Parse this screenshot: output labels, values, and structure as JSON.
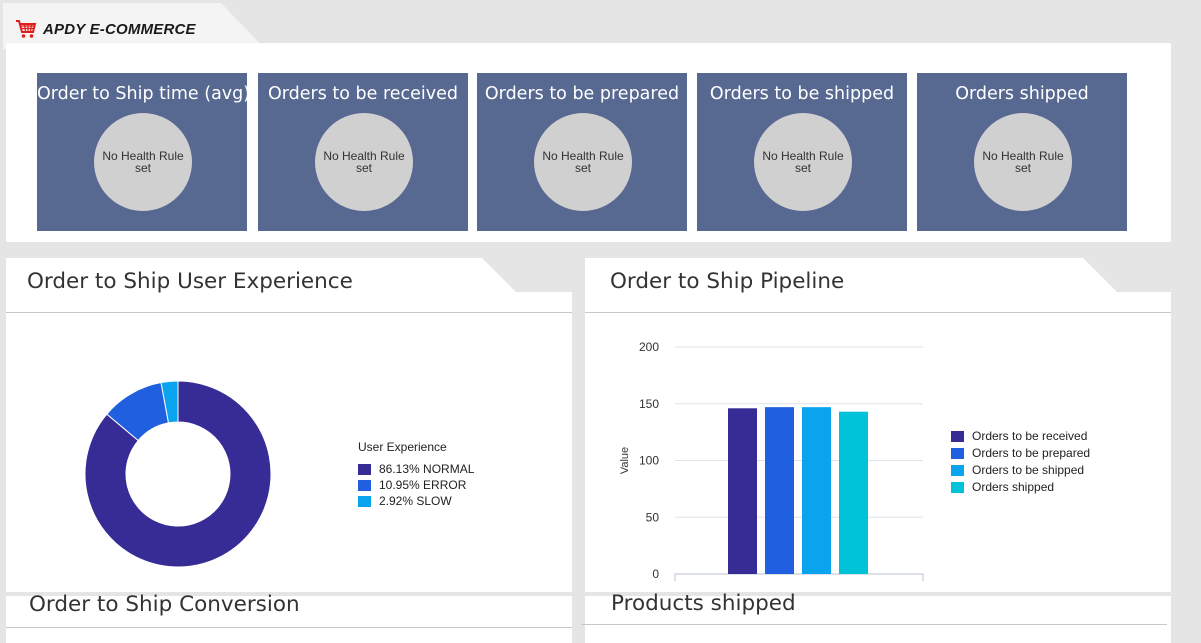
{
  "app": {
    "title": "APDY E-COMMERCE",
    "logo_icon": "shopping-cart-icon",
    "logo_color": "#e11d1d"
  },
  "tiles": [
    {
      "title": "Order to Ship time (avg)",
      "status": "No Health Rule set"
    },
    {
      "title": "Orders to be received",
      "status": "No Health Rule set"
    },
    {
      "title": "Orders to be prepared",
      "status": "No Health Rule set"
    },
    {
      "title": "Orders to be shipped",
      "status": "No Health Rule set"
    },
    {
      "title": "Orders shipped",
      "status": "No Health Rule set"
    }
  ],
  "panels": {
    "user_experience": "Order to Ship User Experience",
    "pipeline": "Order to Ship Pipeline",
    "conversion": "Order to Ship Conversion",
    "products_shipped": "Products shipped"
  },
  "colors": {
    "tile_bg": "#576891",
    "normal": "#372b96",
    "error": "#1f5fe0",
    "slow": "#0aa4ee",
    "shipped": "#00c2d8"
  },
  "chart_data": [
    {
      "type": "pie",
      "legend_title": "User Experience",
      "legend_position": "right",
      "slices": [
        {
          "label": "86.13% NORMAL",
          "value": 86.13,
          "color": "#372b96"
        },
        {
          "label": "10.95% ERROR",
          "value": 10.95,
          "color": "#1f5fe0"
        },
        {
          "label": "2.92% SLOW",
          "value": 2.92,
          "color": "#0aa4ee"
        }
      ]
    },
    {
      "type": "bar",
      "ylabel": "Value",
      "ylim": [
        0,
        200
      ],
      "yticks": [
        0,
        50,
        100,
        150,
        200
      ],
      "grid": true,
      "legend_position": "right",
      "series": [
        {
          "name": "Orders to be received",
          "value": 146,
          "color": "#372b96"
        },
        {
          "name": "Orders to be prepared",
          "value": 147,
          "color": "#1f5fe0"
        },
        {
          "name": "Orders to be shipped",
          "value": 147,
          "color": "#0aa4ee"
        },
        {
          "name": "Orders shipped",
          "value": 143,
          "color": "#00c2d8"
        }
      ]
    }
  ]
}
